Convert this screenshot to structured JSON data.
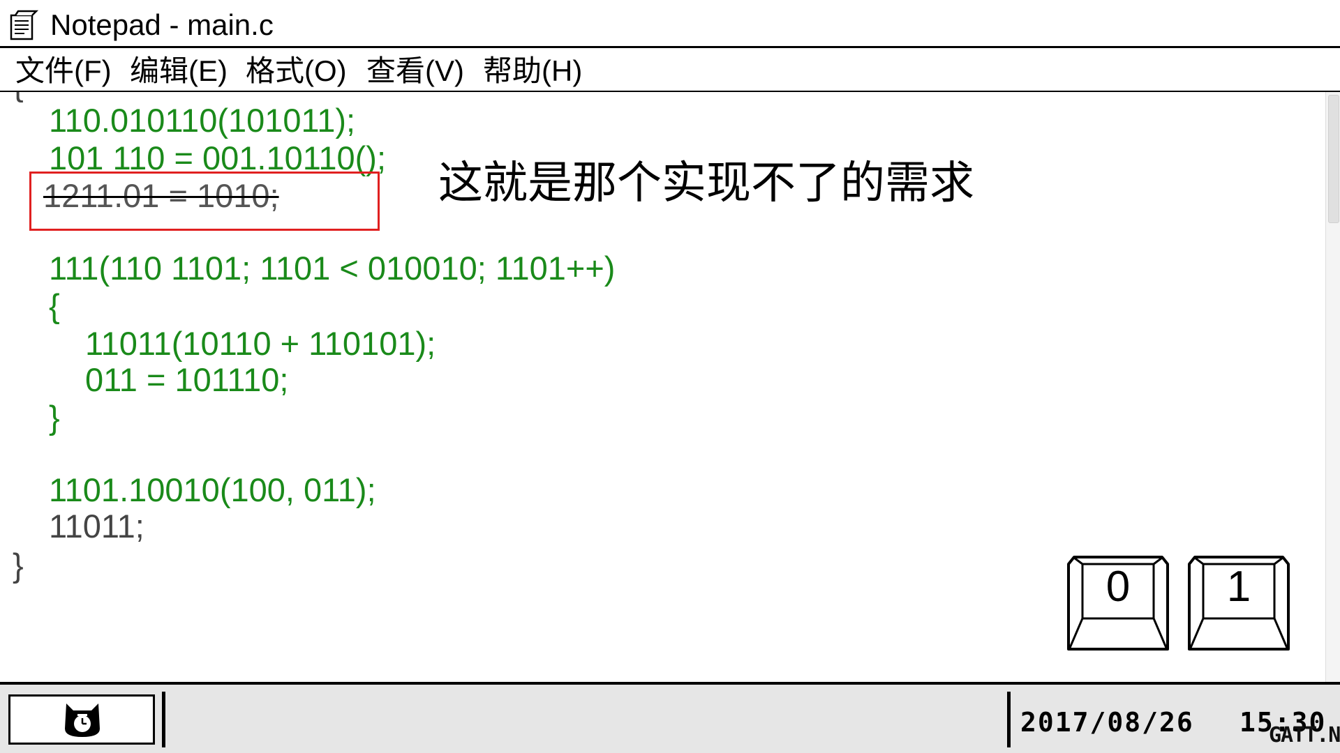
{
  "window": {
    "title": "Notepad - main.c",
    "icon": "notepad-icon"
  },
  "menu": [
    {
      "label": "文件(F)"
    },
    {
      "label": "编辑(E)"
    },
    {
      "label": "格式(O)"
    },
    {
      "label": "查看(V)"
    },
    {
      "label": "帮助(H)"
    }
  ],
  "editor": {
    "lines": [
      "{",
      "110.010110(101011);",
      "101 110 = 001.10110();",
      "1211.01 = 1010;",
      "111(110 1101; 1101 < 010010; 1101++)",
      "{",
      "11011(10110 + 110101);",
      "011 = 101110;",
      "}",
      "1101.10010(100, 011);",
      "11011;",
      "}"
    ],
    "code_color": "#1a8a1a",
    "highlight_color": "#e02020"
  },
  "annotation": {
    "text": "这就是那个实现不了的需求"
  },
  "keys": [
    {
      "label": "0"
    },
    {
      "label": "1"
    }
  ],
  "taskbar": {
    "start_icon": "clock-cat-icon",
    "date": "2017/08/26",
    "time": "15:30",
    "watermark": "GATT.NET"
  }
}
